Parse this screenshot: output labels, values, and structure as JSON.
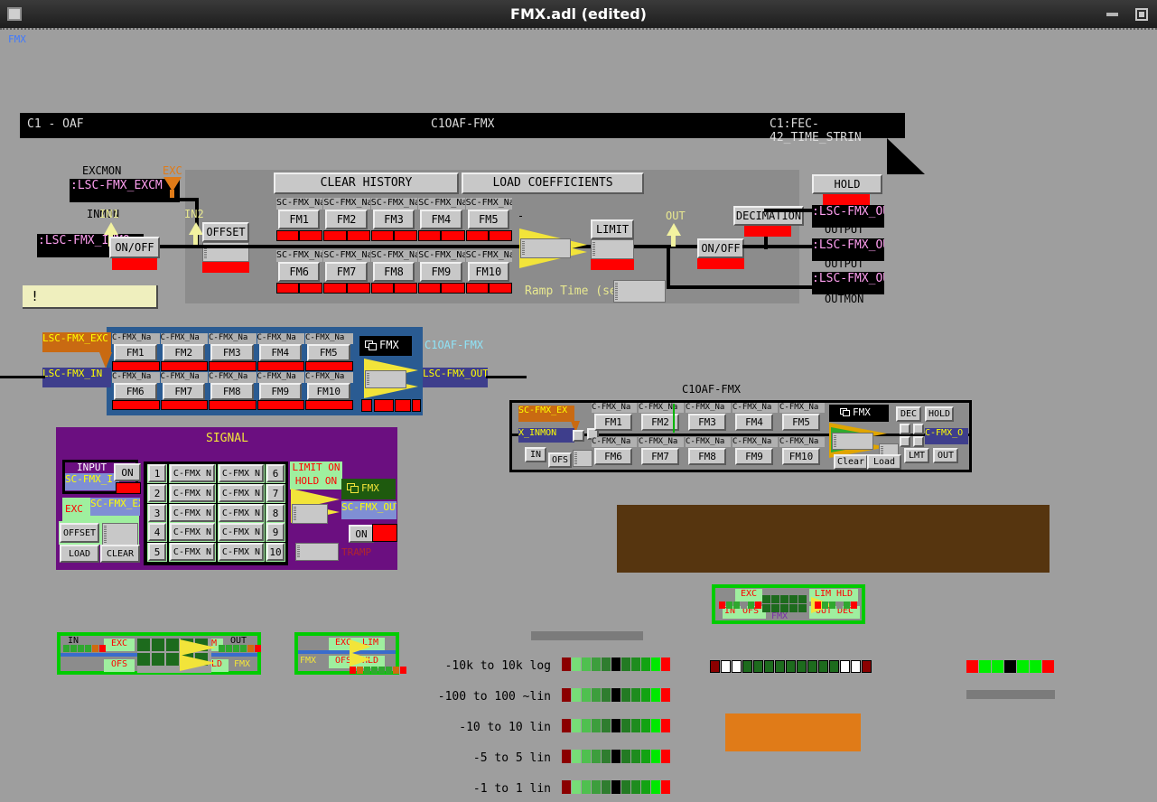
{
  "window": {
    "title": "FMX.adl (edited)",
    "icons": {
      "app": "window-icon",
      "minimize": "minimize-icon",
      "maximize": "maximize-icon"
    },
    "tab_label": "FMX"
  },
  "main_panel": {
    "header_left": "C1 - OAF",
    "header_center": "C1OAF-FMX",
    "header_right": "C1:FEC-42_TIME_STRIN",
    "labels": {
      "excmon": "EXCMON",
      "inmon": "INMON",
      "exc": "EXC",
      "in1": "IN1",
      "in2": "IN2",
      "out": "OUT",
      "output1": "OUTPUT",
      "output2": "OUTPUT",
      "outmon": "OUTMON",
      "ramp_time": "Ramp Time (sec):"
    },
    "pvs": {
      "excmon": ":LSC-FMX_EXCM",
      "inmon": ":LSC-FMX_INMO",
      "output1": ":LSC-FMX_OUTP",
      "output2": ":LSC-FMX_OUTP",
      "outmon": ":LSC-FMX_OUTM"
    },
    "buttons": {
      "clear_history": "CLEAR HISTORY",
      "load_coefficients": "LOAD COEFFICIENTS",
      "onoff_in": "ON/OFF",
      "offset": "OFFSET",
      "limit": "LIMIT",
      "onoff_out": "ON/OFF",
      "decimation": "DECIMATION",
      "hold_output": "HOLD OUTPUT"
    },
    "alarm_text": "!",
    "filter_row1": [
      "FM1",
      "FM2",
      "FM3",
      "FM4",
      "FM5"
    ],
    "filter_row2": [
      "FM6",
      "FM7",
      "FM8",
      "FM9",
      "FM10"
    ],
    "filter_name_label": "SC-FMX_Na"
  },
  "blue_panel": {
    "title": "C1OAF-FMX",
    "fmx_badge": "FMX",
    "input_pv": "LSC-FMX_IN",
    "exc_pv": "LSC-FMX_EXC",
    "out_pv": "LSC-FMX_OUT",
    "filter_name_label": "C-FMX_Na",
    "filter_row1": [
      "FM1",
      "FM2",
      "FM3",
      "FM4",
      "FM5"
    ],
    "filter_row2": [
      "FM6",
      "FM7",
      "FM8",
      "FM9",
      "FM10"
    ]
  },
  "compact_panel": {
    "title": "C1OAF-FMX",
    "fmx_badge": "FMX",
    "exc_pv": "SC-FMX_EX",
    "inmon_pv": "X_INMON",
    "out_pv": "C-FMX_O",
    "filter_name_label": "C-FMX_Na",
    "filter_row1": [
      "FM1",
      "FM2",
      "FM3",
      "FM4",
      "FM5"
    ],
    "filter_row2": [
      "FM6",
      "FM7",
      "FM8",
      "FM9",
      "FM10"
    ],
    "buttons": {
      "in": "IN",
      "ofs": "OFS",
      "dec": "DEC",
      "hold": "HOLD",
      "clear": "Clear",
      "load": "Load",
      "lmt": "LMT",
      "out": "OUT"
    }
  },
  "signal_panel": {
    "title": "SIGNAL",
    "input_label": "INPUT",
    "input_pv": "SC-FMX_I",
    "on_button": "ON",
    "exc_label": "EXC",
    "exc_pv": "SC-FMX_EX",
    "offset_button": "OFFSET",
    "load_button": "LOAD",
    "clear_button": "CLEAR",
    "rows": [
      {
        "num": "1",
        "a": "C-FMX N",
        "b": "C-FMX N",
        "num2": "6"
      },
      {
        "num": "2",
        "a": "C-FMX N",
        "b": "C-FMX N",
        "num2": "7"
      },
      {
        "num": "3",
        "a": "C-FMX N",
        "b": "C-FMX N",
        "num2": "8"
      },
      {
        "num": "4",
        "a": "C-FMX N",
        "b": "C-FMX N",
        "num2": "9"
      },
      {
        "num": "5",
        "a": "C-FMX N",
        "b": "C-FMX N",
        "num2": "10"
      }
    ],
    "limit_on": "LIMIT ON",
    "hold_on": "HOLD ON",
    "fmx_badge": "FMX",
    "out_pv": "SC-FMX_OUT",
    "out_on": "ON",
    "tramp": "TRAMP"
  },
  "mini_widgets": {
    "w1": {
      "in": "IN",
      "exc": "EXC",
      "ofs": "OFS",
      "lim": "LIM",
      "hold": "HOLD",
      "out": "OUT",
      "fmx": "FMX"
    },
    "w2": {
      "exc": "EXC",
      "lim": "LIM",
      "ofs": "OFS",
      "hld": "HLD",
      "fmx": "FMX"
    },
    "w3": {
      "exc": "EXC",
      "in": "IN",
      "ofs": "OFS",
      "lim_hld": "LIM HLD",
      "out_dec": "OUT DEC",
      "fmx": "FMX"
    }
  },
  "colorbars": {
    "rows": [
      {
        "label": "-10k to 10k log"
      },
      {
        "label": "-100 to 100 ~lin"
      },
      {
        "label": "-10 to 10 lin"
      },
      {
        "label": "-5 to 5 lin"
      },
      {
        "label": "-1 to 1 lin"
      }
    ],
    "swatches": [
      "#8b0000",
      "#77dd77",
      "#4fc04f",
      "#3d9e3d",
      "#2f7d2f",
      "#000000",
      "#237a23",
      "#1e8c1e",
      "#13a313",
      "#00e800",
      "#ff0000"
    ],
    "strip2": [
      "#8b0000",
      "#ffffff",
      "#ffffff",
      "#1d6b1d",
      "#1d6b1d",
      "#1d6b1d",
      "#1d6b1d",
      "#1d6b1d",
      "#1d6b1d",
      "#1d6b1d",
      "#1d6b1d",
      "#1d6b1d",
      "#ffffff",
      "#ffffff",
      "#8b0000"
    ],
    "strip3": [
      "#ff0000",
      "#00ee00",
      "#00ee00",
      "#000000",
      "#00ee00",
      "#00ee00",
      "#ff0000"
    ]
  },
  "blocks": {
    "brown": "#56350f",
    "orange": "#e07b18",
    "gray_strip": "#7b7b7b"
  },
  "colors": {
    "background": "#9e9e9e",
    "panel_gray": "#8c8c8c",
    "blue_panel": "#2a5b92",
    "purple_panel": "#6b0f80",
    "green_border": "#00cc00",
    "yellow": "#f2f27a",
    "accent_pv_text": "#ff9ff0"
  }
}
